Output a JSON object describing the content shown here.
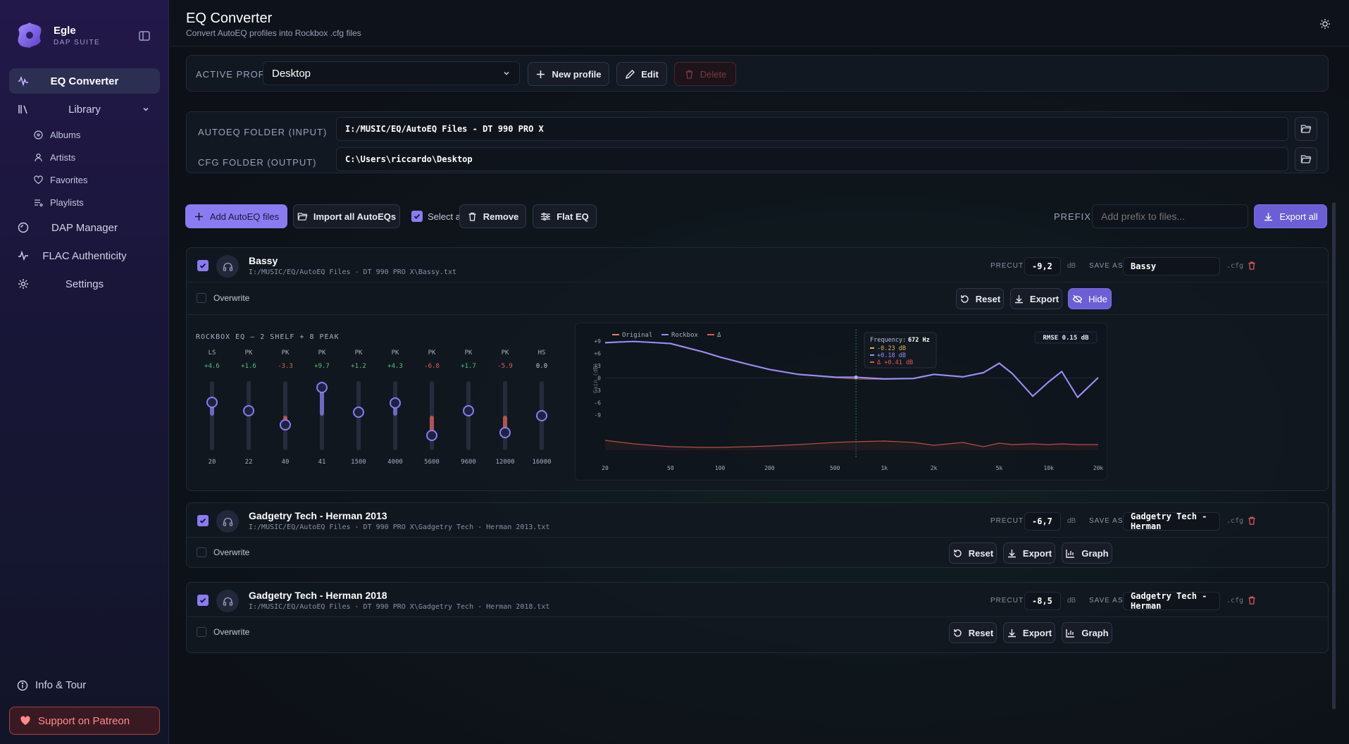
{
  "brand": {
    "name": "Egle",
    "subtitle": "DAP SUITE"
  },
  "nav": {
    "eq": "EQ Converter",
    "library": "Library",
    "albums": "Albums",
    "artists": "Artists",
    "favorites": "Favorites",
    "playlists": "Playlists",
    "dap": "DAP Manager",
    "flac": "FLAC Authenticity",
    "settings": "Settings",
    "info": "Info & Tour",
    "patreon": "Support on Patreon"
  },
  "header": {
    "title": "EQ Converter",
    "subtitle": "Convert AutoEQ profiles into Rockbox .cfg files"
  },
  "profile": {
    "label": "ACTIVE PROFILE",
    "value": "Desktop",
    "new": "New profile",
    "edit": "Edit",
    "delete": "Delete"
  },
  "folders": {
    "input_label": "AUTOEQ FOLDER (INPUT)",
    "input_value": "I:/MUSIC/EQ/AutoEQ Files - DT 990 PRO X",
    "output_label": "CFG FOLDER (OUTPUT)",
    "output_value": "C:\\Users\\riccardo\\Desktop"
  },
  "toolbar": {
    "add": "Add AutoEQ files",
    "import": "Import all AutoEQs",
    "select_all": "Select all",
    "remove": "Remove",
    "flat": "Flat EQ",
    "prefix_label": "PREFIX",
    "prefix_placeholder": "Add prefix to files...",
    "export_all": "Export all"
  },
  "common": {
    "precut": "PRECUT",
    "db": "dB",
    "save_as": "SAVE AS",
    "cfg": ".cfg",
    "overwrite": "Overwrite",
    "reset": "Reset",
    "export": "Export",
    "hide": "Hide",
    "graph": "Graph"
  },
  "files": [
    {
      "name": "Bassy",
      "path": "I:/MUSIC/EQ/AutoEQ Files - DT 990 PRO X\\Bassy.txt",
      "precut": "-9,2",
      "save_as": "Bassy"
    },
    {
      "name": "Gadgetry Tech - Herman 2013",
      "path": "I:/MUSIC/EQ/AutoEQ Files - DT 990 PRO X\\Gadgetry Tech - Herman 2013.txt",
      "precut": "-6,7",
      "save_as": "Gadgetry Tech - Herman"
    },
    {
      "name": "Gadgetry Tech - Herman 2018",
      "path": "I:/MUSIC/EQ/AutoEQ Files - DT 990 PRO X\\Gadgetry Tech - Herman 2018.txt",
      "precut": "-8,5",
      "save_as": "Gadgetry Tech - Herman"
    }
  ],
  "eq": {
    "title": "ROCKBOX EQ — 2 SHELF + 8 PEAK",
    "bands": [
      {
        "type": "LS",
        "gain": "+4.6",
        "gain_value": 4.6,
        "freq": "20"
      },
      {
        "type": "PK",
        "gain": "+1.6",
        "gain_value": 1.6,
        "freq": "22"
      },
      {
        "type": "PK",
        "gain": "-3.3",
        "gain_value": -3.3,
        "freq": "40"
      },
      {
        "type": "PK",
        "gain": "+9.7",
        "gain_value": 9.7,
        "freq": "41"
      },
      {
        "type": "PK",
        "gain": "+1.2",
        "gain_value": 1.2,
        "freq": "1500"
      },
      {
        "type": "PK",
        "gain": "+4.3",
        "gain_value": 4.3,
        "freq": "4000"
      },
      {
        "type": "PK",
        "gain": "-6.8",
        "gain_value": -6.8,
        "freq": "5600"
      },
      {
        "type": "PK",
        "gain": "+1.7",
        "gain_value": 1.7,
        "freq": "9600"
      },
      {
        "type": "PK",
        "gain": "-5.9",
        "gain_value": -5.9,
        "freq": "12000"
      },
      {
        "type": "HS",
        "gain": "0.0",
        "gain_value": 0.0,
        "freq": "16000"
      }
    ],
    "gain_range": [
      -12,
      12
    ]
  },
  "chart_data": {
    "type": "line",
    "legend": [
      "Original",
      "Rockbox",
      "Δ"
    ],
    "legend_position": "top-left",
    "rmse": "RMSE 0.15 dB",
    "ylabel": "Gain (dB)",
    "yticks": [
      "+9",
      "+6",
      "+3",
      "0",
      "-3",
      "-6",
      "-9"
    ],
    "xticks": [
      "20",
      "50",
      "100",
      "200",
      "500",
      "1k",
      "2k",
      "5k",
      "10k",
      "20k"
    ],
    "x_scale": "log",
    "x": [
      20,
      30,
      50,
      80,
      100,
      150,
      200,
      300,
      500,
      672,
      1000,
      1500,
      2000,
      3000,
      4000,
      5000,
      6000,
      8000,
      10000,
      12000,
      15000,
      20000
    ],
    "series": [
      {
        "name": "Original",
        "color": "#d9826a",
        "values": [
          8.5,
          8.9,
          8.3,
          6.2,
          5.0,
          3.2,
          2.0,
          0.8,
          0.1,
          -0.23,
          -0.3,
          -0.2,
          0.8,
          0.2,
          1.2,
          3.5,
          1.0,
          -4.5,
          -1.0,
          1.5,
          -4.8,
          0.0
        ]
      },
      {
        "name": "Rockbox",
        "color": "#9b8cff",
        "values": [
          8.6,
          8.9,
          8.4,
          6.3,
          5.1,
          3.3,
          2.1,
          0.9,
          0.2,
          0.18,
          -0.2,
          -0.1,
          0.9,
          0.3,
          1.3,
          3.6,
          1.1,
          -4.4,
          -0.9,
          1.6,
          -4.7,
          0.1
        ]
      },
      {
        "name": "Δ",
        "color": "#e35a4f",
        "values": [
          0.6,
          0.1,
          -0.3,
          -0.4,
          -0.4,
          -0.3,
          -0.2,
          0.0,
          0.3,
          0.41,
          0.5,
          0.3,
          -0.1,
          0.3,
          -0.3,
          0.2,
          0.0,
          0.1,
          0.0,
          0.1,
          0.0,
          0.0
        ]
      }
    ],
    "tooltip": {
      "label": "Frequency:",
      "frequency": "672 Hz",
      "original": "-0.23 dB",
      "rockbox": "+0.18 dB",
      "delta": "Δ +0.41 dB"
    }
  },
  "colors": {
    "accent": "#8a7cf0",
    "positive": "#56c27a",
    "negative": "#e0605c",
    "neutral": "#c9cdd8"
  }
}
